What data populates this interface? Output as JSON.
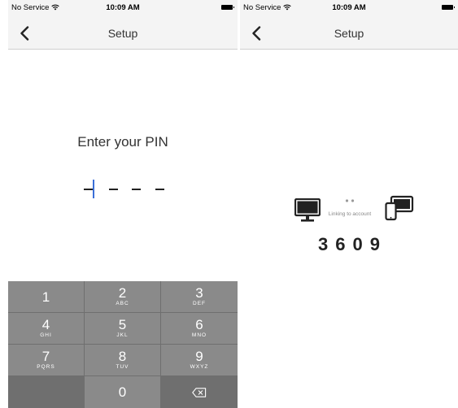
{
  "status_bar": {
    "carrier": "No Service",
    "time": "10:09 AM"
  },
  "setup_pin_screen": {
    "nav_title": "Setup",
    "prompt": "Enter your PIN",
    "pin_slots": 4,
    "keypad": [
      {
        "digit": "1",
        "letters": ""
      },
      {
        "digit": "2",
        "letters": "ABC"
      },
      {
        "digit": "3",
        "letters": "DEF"
      },
      {
        "digit": "4",
        "letters": "GHI"
      },
      {
        "digit": "5",
        "letters": "JKL"
      },
      {
        "digit": "6",
        "letters": "MNO"
      },
      {
        "digit": "7",
        "letters": "PQRS"
      },
      {
        "digit": "8",
        "letters": "TUV"
      },
      {
        "digit": "9",
        "letters": "WXYZ"
      },
      {
        "digit": "",
        "letters": ""
      },
      {
        "digit": "0",
        "letters": ""
      }
    ],
    "delete_icon": "backspace-icon"
  },
  "linking_screen": {
    "nav_title": "Setup",
    "linking_label": "Linking to account",
    "code": "3609",
    "left_icon": "monitor-icon",
    "right_icon": "devices-icon"
  },
  "colors": {
    "bar_background": "#f4f4f4",
    "keypad_key": "#8a8a8a",
    "keypad_background": "#6f6f6f",
    "cursor": "#3b6fd8"
  }
}
